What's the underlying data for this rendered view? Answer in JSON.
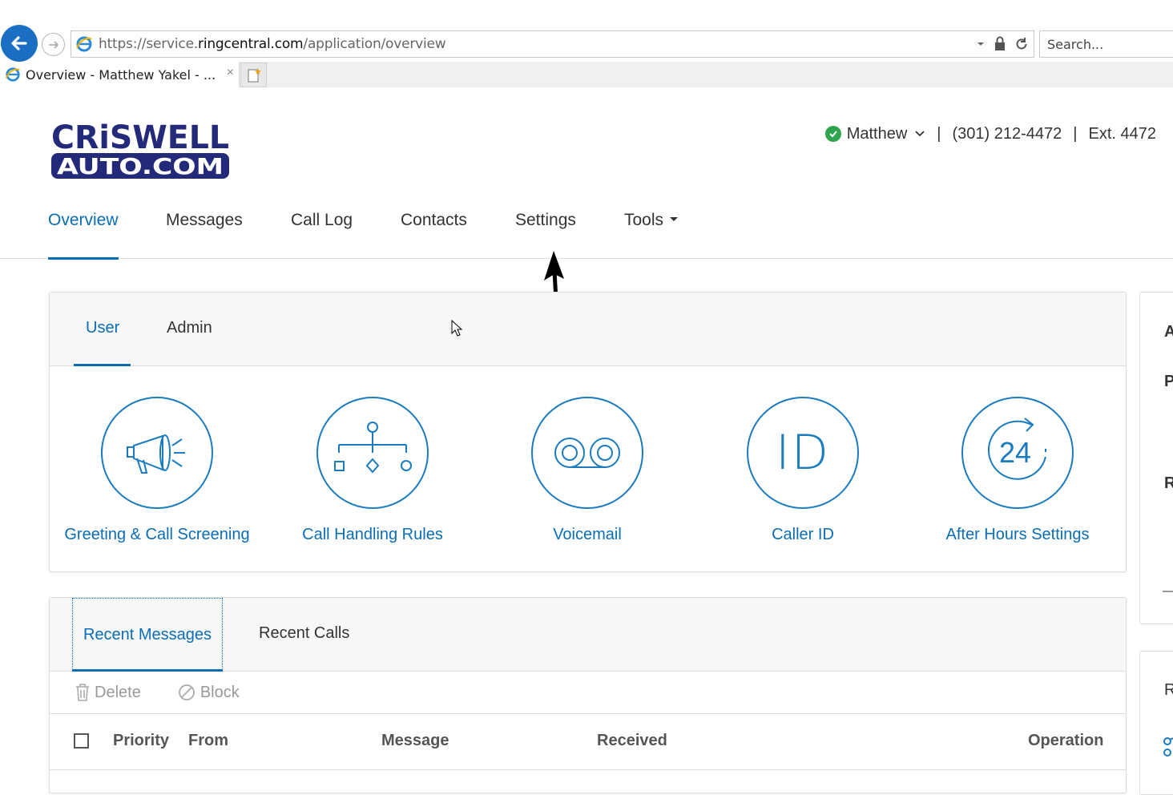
{
  "browser": {
    "url_prefix": "https://service.",
    "url_host": "ringcentral.com",
    "url_path": "/application/overview",
    "search_placeholder": "Search...",
    "tab_title": "Overview - Matthew Yakel - ...",
    "tab_close": "×"
  },
  "header": {
    "logo_line1": "CRiSWELL",
    "logo_line2": "AUTO.COM",
    "user_name": "Matthew",
    "separator": "|",
    "phone": "(301) 212-4472",
    "extension": "Ext. 4472",
    "status_color": "#2ea44f"
  },
  "nav": {
    "items": [
      {
        "label": "Overview"
      },
      {
        "label": "Messages"
      },
      {
        "label": "Call Log"
      },
      {
        "label": "Contacts"
      },
      {
        "label": "Settings"
      },
      {
        "label": "Tools"
      }
    ],
    "active": "Overview",
    "accent_color": "#0a6db5"
  },
  "settings_panel": {
    "tabs": [
      {
        "label": "User"
      },
      {
        "label": "Admin"
      }
    ],
    "features": [
      {
        "label": "Greeting & Call Screening",
        "icon": "megaphone-icon"
      },
      {
        "label": "Call Handling Rules",
        "icon": "call-flow-icon"
      },
      {
        "label": "Voicemail",
        "icon": "voicemail-icon"
      },
      {
        "label": "Caller ID",
        "icon": "caller-id-icon"
      },
      {
        "label": "After Hours Settings",
        "icon": "clock-24-icon"
      }
    ],
    "caller_id_glyph": "ID",
    "after_hours_glyph": "24"
  },
  "messages_panel": {
    "tabs": [
      {
        "label": "Recent Messages"
      },
      {
        "label": "Recent Calls"
      }
    ],
    "toolbar": {
      "delete_label": "Delete",
      "block_label": "Block"
    },
    "columns": [
      "Priority",
      "From",
      "Message",
      "Received",
      "Operation"
    ]
  },
  "side_cards": {
    "card1_letters": [
      "A",
      "P",
      "R"
    ],
    "card2_letters": [
      "R"
    ]
  }
}
